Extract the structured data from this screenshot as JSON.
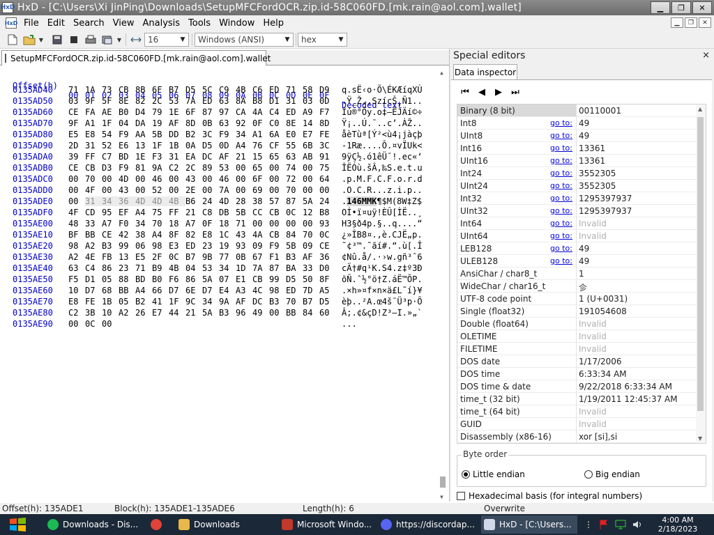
{
  "window": {
    "title": "HxD - [C:\\Users\\Xi JinPing\\Downloads\\SetupMFCFordOCR.zip.id-58C060FD.[mk.rain@aol.com].wallet]",
    "app_icon": "HxD",
    "mdi_icon": "HxD"
  },
  "menu": [
    "File",
    "Edit",
    "Search",
    "View",
    "Analysis",
    "Tools",
    "Window",
    "Help"
  ],
  "toolbar": {
    "bytes_per_row": "16",
    "charset": "Windows (ANSI)",
    "offset_base": "hex"
  },
  "file_tab": "SetupMFCFordOCR.zip.id-58C060FD.[mk.rain@aol.com].wallet",
  "hex_header": {
    "offset": "Offset(h)",
    "columns": [
      "00",
      "01",
      "02",
      "03",
      "04",
      "05",
      "06",
      "07",
      "08",
      "09",
      "0A",
      "0B",
      "0C",
      "0D",
      "0E",
      "0F"
    ],
    "decoded": "Decoded text"
  },
  "hex_rows": [
    {
      "offset": "0135AD40",
      "bytes": [
        "71",
        "1A",
        "73",
        "CB",
        "8B",
        "6F",
        "B7",
        "D5",
        "5C",
        "C9",
        "4B",
        "C6",
        "ED",
        "71",
        "58",
        "D9"
      ],
      "text": "q.sË‹o·Õ\\ÉKÆíqXÙ"
    },
    {
      "offset": "0135AD50",
      "bytes": [
        "03",
        "9F",
        "5F",
        "8E",
        "82",
        "2C",
        "53",
        "7A",
        "ED",
        "63",
        "8A",
        "B8",
        "D1",
        "31",
        "03",
        "0D"
      ],
      "text": ".Ÿ_Ž‚,SzícŠ¸Ñ1.."
    },
    {
      "offset": "0135AD60",
      "bytes": [
        "CE",
        "FA",
        "AE",
        "B0",
        "D4",
        "79",
        "1E",
        "6F",
        "87",
        "97",
        "CA",
        "4A",
        "C4",
        "ED",
        "A9",
        "F7"
      ],
      "text": "Îú®°Ôy.o‡—ÊJÄí©÷"
    },
    {
      "offset": "0135AD70",
      "bytes": [
        "9F",
        "A1",
        "1F",
        "04",
        "DA",
        "19",
        "AF",
        "8D",
        "0B",
        "63",
        "92",
        "0F",
        "C0",
        "8E",
        "14",
        "8D"
      ],
      "text": "Ÿ¡..Ú.¯..c’.ÀŽ.."
    },
    {
      "offset": "0135AD80",
      "bytes": [
        "E5",
        "E8",
        "54",
        "F9",
        "AA",
        "5B",
        "DD",
        "B2",
        "3C",
        "F9",
        "34",
        "A1",
        "6A",
        "E0",
        "E7",
        "FE"
      ],
      "text": "åèTùª[Ý²<ù4¡jàçþ"
    },
    {
      "offset": "0135AD90",
      "bytes": [
        "2D",
        "31",
        "52",
        "E6",
        "13",
        "1F",
        "1B",
        "0A",
        "D5",
        "0D",
        "A4",
        "76",
        "CF",
        "55",
        "6B",
        "3C"
      ],
      "text": "-1Ræ....Õ.¤vÏUk<"
    },
    {
      "offset": "0135ADA0",
      "bytes": [
        "39",
        "FF",
        "C7",
        "BD",
        "1E",
        "F3",
        "31",
        "EA",
        "DC",
        "AF",
        "21",
        "15",
        "65",
        "63",
        "AB",
        "91"
      ],
      "text": "9ÿÇ½.ó1êÜ¯!.ec«‘"
    },
    {
      "offset": "0135ADB0",
      "bytes": [
        "CE",
        "CB",
        "D3",
        "F9",
        "81",
        "9A",
        "C2",
        "2C",
        "89",
        "53",
        "00",
        "65",
        "00",
        "74",
        "00",
        "75"
      ],
      "text": "ÎËÓù.šÂ,‰S.e.t.u"
    },
    {
      "offset": "0135ADC0",
      "bytes": [
        "00",
        "70",
        "00",
        "4D",
        "00",
        "46",
        "00",
        "43",
        "00",
        "46",
        "00",
        "6F",
        "00",
        "72",
        "00",
        "64"
      ],
      "text": ".p.M.F.C.F.o.r.d"
    },
    {
      "offset": "0135ADD0",
      "bytes": [
        "00",
        "4F",
        "00",
        "43",
        "00",
        "52",
        "00",
        "2E",
        "00",
        "7A",
        "00",
        "69",
        "00",
        "70",
        "00",
        "00"
      ],
      "text": ".O.C.R...z.i.p.."
    },
    {
      "offset": "0135ADE0",
      "bytes": [
        "00",
        "31",
        "34",
        "36",
        "4D",
        "4D",
        "4B",
        "B6",
        "24",
        "4D",
        "28",
        "38",
        "57",
        "87",
        "5A",
        "24"
      ],
      "text": ".146MMK¶$M(8W‡Z$",
      "sel": [
        1,
        2,
        3,
        4,
        5,
        6
      ],
      "cursor": 1
    },
    {
      "offset": "0135ADF0",
      "bytes": [
        "4F",
        "CD",
        "95",
        "EF",
        "A4",
        "75",
        "FF",
        "21",
        "C8",
        "DB",
        "5B",
        "CC",
        "CB",
        "0C",
        "12",
        "B8"
      ],
      "text": "OÍ•ï¤uÿ!ÈÛ[ÌË..¸"
    },
    {
      "offset": "0135AE00",
      "bytes": [
        "48",
        "33",
        "A7",
        "F0",
        "34",
        "70",
        "18",
        "A7",
        "0F",
        "18",
        "71",
        "00",
        "00",
        "00",
        "00",
        "93"
      ],
      "text": "H3§ð4p.§..q....“"
    },
    {
      "offset": "0135AE10",
      "bytes": [
        "BF",
        "BB",
        "CE",
        "42",
        "38",
        "A4",
        "8F",
        "82",
        "E8",
        "1C",
        "43",
        "4A",
        "CB",
        "84",
        "70",
        "0C"
      ],
      "text": "¿»ÎB8¤.‚è.CJË„p."
    },
    {
      "offset": "0135AE20",
      "bytes": [
        "98",
        "A2",
        "B3",
        "99",
        "06",
        "98",
        "E3",
        "ED",
        "23",
        "19",
        "93",
        "09",
        "F9",
        "5B",
        "09",
        "CE"
      ],
      "text": "˜¢³™.˜ãí#.“.ù[.Î"
    },
    {
      "offset": "0135AE30",
      "bytes": [
        "A2",
        "4E",
        "FB",
        "13",
        "E5",
        "2F",
        "0C",
        "B7",
        "9B",
        "77",
        "0B",
        "67",
        "F1",
        "B3",
        "AF",
        "36"
      ],
      "text": "¢Nû.å/.·›w.gñ³¯6"
    },
    {
      "offset": "0135AE40",
      "bytes": [
        "63",
        "C4",
        "86",
        "23",
        "71",
        "B9",
        "4B",
        "04",
        "53",
        "34",
        "1D",
        "7A",
        "87",
        "BA",
        "33",
        "D0"
      ],
      "text": "cÄ†#q¹K.S4.z‡º3Ð"
    },
    {
      "offset": "0135AE50",
      "bytes": [
        "F5",
        "D1",
        "05",
        "88",
        "BD",
        "B0",
        "F6",
        "86",
        "5A",
        "07",
        "E1",
        "CB",
        "99",
        "D5",
        "50",
        "8F"
      ],
      "text": "õÑ.ˆ½°ö†Z.áË™ÕP."
    },
    {
      "offset": "0135AE60",
      "bytes": [
        "10",
        "D7",
        "68",
        "BB",
        "A4",
        "66",
        "D7",
        "6E",
        "D7",
        "E4",
        "A3",
        "4C",
        "98",
        "ED",
        "7D",
        "A5"
      ],
      "text": ".×h»¤f×n×ä£L˜í}¥"
    },
    {
      "offset": "0135AE70",
      "bytes": [
        "E8",
        "FE",
        "1B",
        "05",
        "B2",
        "41",
        "1F",
        "9C",
        "34",
        "9A",
        "AF",
        "DC",
        "B3",
        "70",
        "B7",
        "D5"
      ],
      "text": "èþ..²A.œ4š¯Ü³p·Õ"
    },
    {
      "offset": "0135AE80",
      "bytes": [
        "C2",
        "3B",
        "10",
        "A2",
        "26",
        "E7",
        "44",
        "21",
        "5A",
        "B3",
        "96",
        "49",
        "00",
        "BB",
        "84",
        "60"
      ],
      "text": "Â;.¢&çD!Z³–I.»„`"
    },
    {
      "offset": "0135AE90",
      "bytes": [
        "00",
        "0C",
        "00"
      ],
      "text": "..."
    }
  ],
  "special_editors": {
    "title": "Special editors",
    "close": "×",
    "tab": "Data inspector",
    "go_to": "go to:",
    "rows": [
      {
        "name": "Binary (8 bit)",
        "value": "00110001",
        "selected": true
      },
      {
        "name": "Int8",
        "value": "49",
        "goto": true
      },
      {
        "name": "UInt8",
        "value": "49",
        "goto": true
      },
      {
        "name": "Int16",
        "value": "13361",
        "goto": true
      },
      {
        "name": "UInt16",
        "value": "13361",
        "goto": true
      },
      {
        "name": "Int24",
        "value": "3552305",
        "goto": true
      },
      {
        "name": "UInt24",
        "value": "3552305",
        "goto": true
      },
      {
        "name": "Int32",
        "value": "1295397937",
        "goto": true
      },
      {
        "name": "UInt32",
        "value": "1295397937",
        "goto": true
      },
      {
        "name": "Int64",
        "value": "Invalid",
        "goto": true,
        "invalid": true
      },
      {
        "name": "UInt64",
        "value": "Invalid",
        "goto": true,
        "invalid": true
      },
      {
        "name": "LEB128",
        "value": "49",
        "goto": true
      },
      {
        "name": "ULEB128",
        "value": "49",
        "goto": true
      },
      {
        "name": "AnsiChar / char8_t",
        "value": "1"
      },
      {
        "name": "WideChar / char16_t",
        "value": "㐱"
      },
      {
        "name": "UTF-8 code point",
        "value": "1 (U+0031)"
      },
      {
        "name": "Single (float32)",
        "value": "191054608"
      },
      {
        "name": "Double (float64)",
        "value": "Invalid",
        "invalid": true
      },
      {
        "name": "OLETIME",
        "value": "Invalid",
        "invalid": true
      },
      {
        "name": "FILETIME",
        "value": "Invalid",
        "invalid": true
      },
      {
        "name": "DOS date",
        "value": "1/17/2006"
      },
      {
        "name": "DOS time",
        "value": "6:33:34 AM"
      },
      {
        "name": "DOS time & date",
        "value": "9/22/2018 6:33:34 AM"
      },
      {
        "name": "time_t (32 bit)",
        "value": "1/19/2011 12:45:37 AM"
      },
      {
        "name": "time_t (64 bit)",
        "value": "Invalid",
        "invalid": true
      },
      {
        "name": "GUID",
        "value": "Invalid",
        "invalid": true
      },
      {
        "name": "Disassembly (x86-16)",
        "value": "xor [si],si"
      }
    ],
    "byte_order_label": "Byte order",
    "little_endian": "Little endian",
    "big_endian": "Big endian",
    "little_endian_selected": true,
    "hex_basis": "Hexadecimal basis (for integral numbers)"
  },
  "status": {
    "offset": "Offset(h): 135ADE1",
    "block": "Block(h): 135ADE1-135ADE6",
    "length": "Length(h): 6",
    "mode": "Overwrite"
  },
  "taskbar": {
    "items": [
      {
        "label": "Downloads - Dis...",
        "icon": "spotify-icon",
        "color": "#1db954"
      },
      {
        "label": "",
        "icon": "chrome-icon",
        "color": "#e0433a"
      },
      {
        "label": "Downloads",
        "icon": "folder-icon",
        "color": "#e8b84a"
      },
      {
        "label": "Microsoft Windo...",
        "icon": "app-window-icon",
        "color": "#c0392b"
      },
      {
        "label": "https://discordap...",
        "icon": "discord-icon",
        "color": "#5865f2"
      },
      {
        "label": "HxD - [C:\\Users...",
        "icon": "hxd-icon",
        "color": "#d0d8e8",
        "active": true
      }
    ],
    "time": "4:00 AM",
    "date": "2/18/2023"
  }
}
